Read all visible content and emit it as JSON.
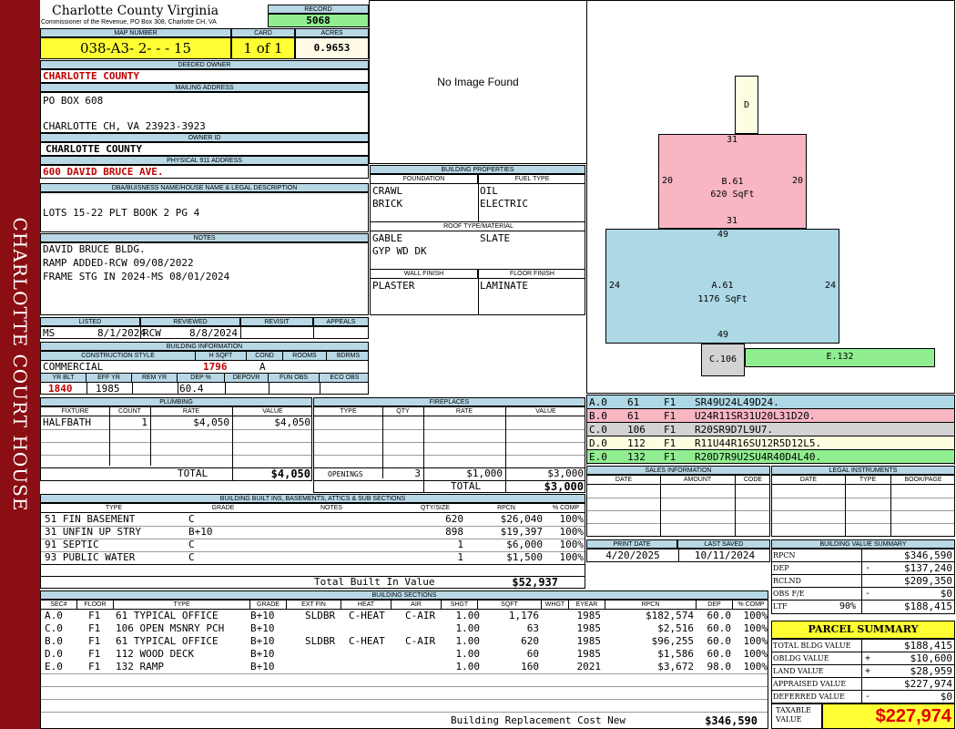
{
  "sidebar_title": "CHARLOTTE COURT HOUSE",
  "header": {
    "county": "Charlotte County Virginia",
    "address": "Commissioner of the Revenue, PO Box 308, Charlotte CH, VA",
    "record_label": "RECORD",
    "record": "5068",
    "map_number_label": "MAP NUMBER",
    "map_number": "038-A3- 2- - - 15",
    "card_label": "CARD",
    "card": "1 of 1",
    "acres_label": "ACRES",
    "acres": "0.9653"
  },
  "owner": {
    "deeded_owner_label": "DEEDED OWNER",
    "deeded_owner": "CHARLOTTE COUNTY",
    "mailing_address_label": "MAILING ADDRESS",
    "mailing_line1": "PO BOX 608",
    "mailing_line2": "CHARLOTTE CH, VA 23923-3923",
    "owner_id_label": "OWNER ID",
    "owner_id": "CHARLOTTE COUNTY",
    "physical_address_label": "PHYSICAL 911 ADDRESS",
    "physical_address": "600 DAVID BRUCE AVE.",
    "legal_label": "DBA/BUISNESS NAME/HOUSE NAME & LEGAL DESCRIPTION",
    "legal": "LOTS 15-22  PLT BOOK 2 PG 4",
    "notes_label": "NOTES",
    "notes": [
      "DAVID BRUCE BLDG.",
      "RAMP ADDED-RCW 09/08/2022",
      "FRAME STG IN 2024-MS 08/01/2024"
    ]
  },
  "status": {
    "listed_label": "LISTED",
    "listed_by": "MS",
    "listed_date": "8/1/2024",
    "reviewed_label": "REVIEWED",
    "reviewed_by": "RCW",
    "reviewed_date": "8/8/2024",
    "revisit_label": "REVISIT",
    "appeals_label": "APPEALS"
  },
  "building_info": {
    "title": "BUILDING INFORMATION",
    "construction_style_label": "CONSTRUCTION STYLE",
    "construction_style": "COMMERCIAL",
    "hsqft_label": "H SQFT",
    "hsqft": "1796",
    "cond_label": "COND",
    "cond": "A",
    "rooms_label": "ROOMS",
    "bdrms_label": "BDRMS",
    "yr_blt_label": "YR BLT",
    "yr_blt": "1840",
    "eff_yr_label": "EFF YR",
    "eff_yr": "1985",
    "rem_yr_label": "REM YR",
    "dep_pct_label": "DEP %",
    "dep_pct": "60.4",
    "depovr_label": "DEPOVR",
    "fun_obs_label": "FUN OBS",
    "eco_obs_label": "ECO OBS"
  },
  "photo": {
    "message": "No Image Found"
  },
  "building_properties": {
    "title": "BUILDING PROPERTIES",
    "foundation_label": "FOUNDATION",
    "fuel_type_label": "FUEL TYPE",
    "foundation": [
      "CRAWL",
      "BRICK"
    ],
    "fuel_type": [
      "OIL",
      "ELECTRIC"
    ],
    "roof_label": "ROOF TYPE/MATERIAL",
    "roof_type": "GABLE",
    "roof_material": "SLATE",
    "roof_extra": "GYP WD DK",
    "wall_finish_label": "WALL FINISH",
    "floor_finish_label": "FLOOR FINISH",
    "wall_finish": "PLASTER",
    "floor_finish": "LAMINATE"
  },
  "sketch": {
    "shapes": [
      {
        "id": "D",
        "label": "D",
        "color": "#fffde0"
      },
      {
        "id": "B",
        "label": "B.61",
        "area": "620 SqFt",
        "color": "#f7b6c2",
        "top": "31",
        "bottom": "31",
        "left": "20",
        "right": "20"
      },
      {
        "id": "A",
        "label": "A.61",
        "area": "1176 SqFt",
        "color": "#add8e6",
        "top": "49",
        "bottom": "49",
        "left": "24",
        "right": "24"
      },
      {
        "id": "C",
        "label": "C.106",
        "color": "#d3d3d3"
      },
      {
        "id": "E",
        "label": "E.132",
        "color": "#90ee90"
      }
    ],
    "legend": [
      {
        "code": "A.0",
        "num": "61",
        "floor": "F1",
        "desc": "SR49U24L49D24.",
        "color": "#add8e6"
      },
      {
        "code": "B.0",
        "num": "61",
        "floor": "F1",
        "desc": "U24R11SR31U20L31D20.",
        "color": "#f7b6c2"
      },
      {
        "code": "C.0",
        "num": "106",
        "floor": "F1",
        "desc": "R20SR9D7L9U7.",
        "color": "#d3d3d3"
      },
      {
        "code": "D.0",
        "num": "112",
        "floor": "F1",
        "desc": "R11U44R16SU12R5D12L5.",
        "color": "#fffde0"
      },
      {
        "code": "E.0",
        "num": "132",
        "floor": "F1",
        "desc": "R20D7R9U2SU4R40D4L40.",
        "color": "#90ee90"
      }
    ]
  },
  "plumbing": {
    "title": "PLUMBING",
    "headers": [
      "FIXTURE",
      "COUNT",
      "RATE",
      "VALUE"
    ],
    "rows": [
      [
        "HALFBATH",
        "1",
        "$4,050",
        "$4,050"
      ]
    ],
    "total_label": "TOTAL",
    "total": "$4,050"
  },
  "fireplaces": {
    "title": "FIREPLACES",
    "headers": [
      "TYPE",
      "QTY",
      "RATE",
      "VALUE"
    ],
    "openings_label": "OPENINGS",
    "openings_qty": "3",
    "openings_rate": "$1,000",
    "openings_value": "$3,000",
    "total_label": "TOTAL",
    "total": "$3,000"
  },
  "sales": {
    "title": "SALES INFORMATION",
    "headers": [
      "DATE",
      "AMOUNT",
      "CODE"
    ]
  },
  "legal_instruments": {
    "title": "LEGAL INSTRUMENTS",
    "headers": [
      "DATE",
      "TYPE",
      "BOOK/PAGE"
    ]
  },
  "print_info": {
    "print_date_label": "PRINT DATE",
    "print_date": "4/20/2025",
    "last_saved_label": "LAST SAVED",
    "last_saved": "10/11/2024"
  },
  "built_ins": {
    "title": "BUILDING BUILT INS, BASEMENTS, ATTICS & SUB SECTIONS",
    "headers": [
      "TYPE",
      "GRADE",
      "NOTES",
      "QTY/SIZE",
      "RPCN",
      "% COMP"
    ],
    "rows": [
      [
        "51 FIN BASEMENT",
        "C",
        "",
        "620",
        "$26,040",
        "100%"
      ],
      [
        "31 UNFIN UP STRY",
        "B+10",
        "",
        "898",
        "$19,397",
        "100%"
      ],
      [
        "91 SEPTIC",
        "C",
        "",
        "1",
        "$6,000",
        "100%"
      ],
      [
        "93 PUBLIC WATER",
        "C",
        "",
        "1",
        "$1,500",
        "100%"
      ]
    ],
    "total_label": "Total Built In Value",
    "total": "$52,937"
  },
  "building_sections": {
    "title": "BUILDING SECTIONS",
    "headers": [
      "SEC#",
      "FLOOR",
      "TYPE",
      "GRADE",
      "EXT FIN",
      "HEAT",
      "AIR",
      "SHGT",
      "SQFT",
      "WHGT",
      "EYEAR",
      "RPCN",
      "DEP",
      "% COMP"
    ],
    "rows": [
      [
        "A.0",
        "F1",
        "61 TYPICAL OFFICE",
        "B+10",
        "SLDBR",
        "C-HEAT",
        "C-AIR",
        "1.00",
        "1,176",
        "",
        "1985",
        "$182,574",
        "60.0",
        "100%"
      ],
      [
        "C.0",
        "F1",
        "106 OPEN MSNRY PCH",
        "B+10",
        "",
        "",
        "",
        "1.00",
        "63",
        "",
        "1985",
        "$2,516",
        "60.0",
        "100%"
      ],
      [
        "B.0",
        "F1",
        "61 TYPICAL OFFICE",
        "B+10",
        "SLDBR",
        "C-HEAT",
        "C-AIR",
        "1.00",
        "620",
        "",
        "1985",
        "$96,255",
        "60.0",
        "100%"
      ],
      [
        "D.0",
        "F1",
        "112 WOOD DECK",
        "B+10",
        "",
        "",
        "",
        "1.00",
        "60",
        "",
        "1985",
        "$1,586",
        "60.0",
        "100%"
      ],
      [
        "E.0",
        "F1",
        "132 RAMP",
        "B+10",
        "",
        "",
        "",
        "1.00",
        "160",
        "",
        "2021",
        "$3,672",
        "98.0",
        "100%"
      ]
    ],
    "replacement_label": "Building Replacement Cost New",
    "replacement": "$346,590"
  },
  "value_summary": {
    "title": "BUILDING VALUE SUMMARY",
    "rows": [
      {
        "label": "RPCN",
        "sign": "",
        "pct": "",
        "value": "$346,590"
      },
      {
        "label": "DEP",
        "sign": "-",
        "pct": "",
        "value": "$137,240"
      },
      {
        "label": "RCLND",
        "sign": "",
        "pct": "",
        "value": "$209,350"
      },
      {
        "label": "OBS F/E",
        "sign": "-",
        "pct": "",
        "value": "$0"
      },
      {
        "label": "LTF",
        "sign": "",
        "pct": "90%",
        "value": "$188,415"
      }
    ]
  },
  "parcel_summary": {
    "title": "PARCEL SUMMARY",
    "rows": [
      {
        "label": "TOTAL BLDG VALUE",
        "sign": "",
        "value": "$188,415"
      },
      {
        "label": "OBLDG VALUE",
        "sign": "+",
        "value": "$10,600"
      },
      {
        "label": "LAND VALUE",
        "sign": "+",
        "value": "$28,959"
      },
      {
        "label": "APPRAISED VALUE",
        "sign": "",
        "value": "$227,974"
      },
      {
        "label": "DEFERRED VALUE",
        "sign": "-",
        "value": "$0"
      }
    ],
    "taxable_label": "TAXABLE VALUE",
    "taxable": "$227,974"
  }
}
